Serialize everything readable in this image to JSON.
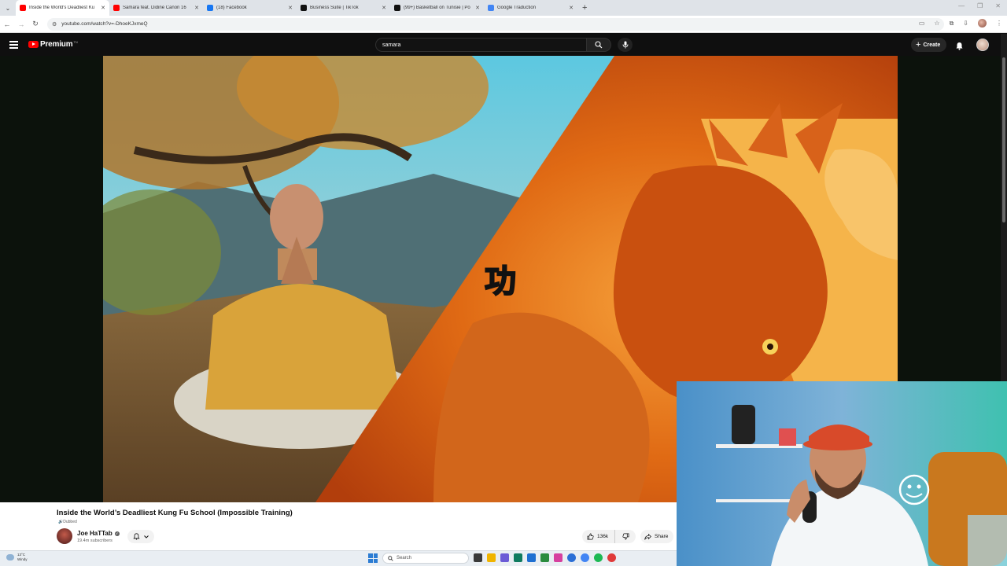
{
  "browser": {
    "tabs": [
      {
        "title": "Inside the World's Deadliest Ku",
        "favicon_color": "#ff0000",
        "active": true
      },
      {
        "title": "Samara feat. Didine Canon 16",
        "favicon_color": "#ff0000",
        "active": false
      },
      {
        "title": "(18) Facebook",
        "favicon_color": "#1877f2",
        "active": false
      },
      {
        "title": "Business Suite | TikTok",
        "favicon_color": "#111111",
        "active": false
      },
      {
        "title": "(99+) Basketball on Tunisie | Po",
        "favicon_color": "#111111",
        "active": false
      },
      {
        "title": "Google Traduction",
        "favicon_color": "#4285f4",
        "active": false
      }
    ],
    "new_tab": "+",
    "url": "youtube.com/watch?v=-DhoeKJxmeQ"
  },
  "youtube": {
    "brand": "Premium",
    "country": "TN",
    "search_value": "samara",
    "create_label": "Create"
  },
  "video": {
    "title": "Inside the World’s Deadliest Kung Fu School (Impossible Training)",
    "dubbed_label": "Dubbed",
    "thumbnail_glyph": "功",
    "channel_name": "Joe HaTTab",
    "subscribers": "19.4m subscribers",
    "likes": "136k",
    "share_label": "Share"
  },
  "taskbar": {
    "temperature": "13°C",
    "weather": "Windy",
    "search_placeholder": "Search",
    "app_colors": [
      "#3a3a3a",
      "#f0b400",
      "#6b5bd6",
      "#0f7b5f",
      "#1e6fd1",
      "#2a8c3f",
      "#d6409f",
      "#2b6fd6",
      "#4285f4",
      "#1db954",
      "#e03a3a"
    ]
  },
  "colors": {
    "accent": "#ff0000",
    "background": "#0f0f0f"
  }
}
